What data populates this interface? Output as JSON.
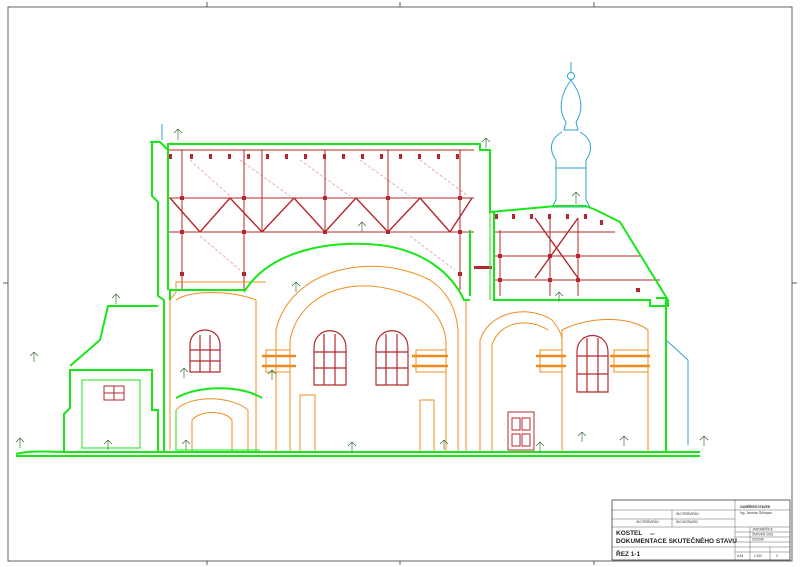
{
  "title_block": {
    "project_label": "KOSTEL",
    "project_suffix": "xxx",
    "document_title": "DOKUMENTACE SKUTEČNÉHO STAVU",
    "drawing_name": "ŘEZ 1-1",
    "organisation": "ZAMĚŘENÍ STAVEB",
    "organisation_person": "Ing. Jaroslav Šrůmpán",
    "prepared_by": "ING.ŠRŮMPÁN",
    "checked_by": "ING.MORAVEC",
    "drawn_by": "ING.ŠRŮMPÁN",
    "location": "JAROMĚŘICE",
    "date": "ČERVEN 2015",
    "doc_number": "2015/08",
    "format": "6 A4",
    "scale": "1:100",
    "sheet_number": "3"
  },
  "colors": {
    "outline": "#19e619",
    "masonry": "#f08c1e",
    "roof_timber": "#d2325a",
    "roof_truss": "#b4282d",
    "tower": "#32a0d2",
    "label": "#1e5a1e",
    "frame": "#3c3c3c"
  },
  "icons": [
    "section-drawing-icon",
    "tower-spire-icon",
    "level-marker-icon"
  ]
}
